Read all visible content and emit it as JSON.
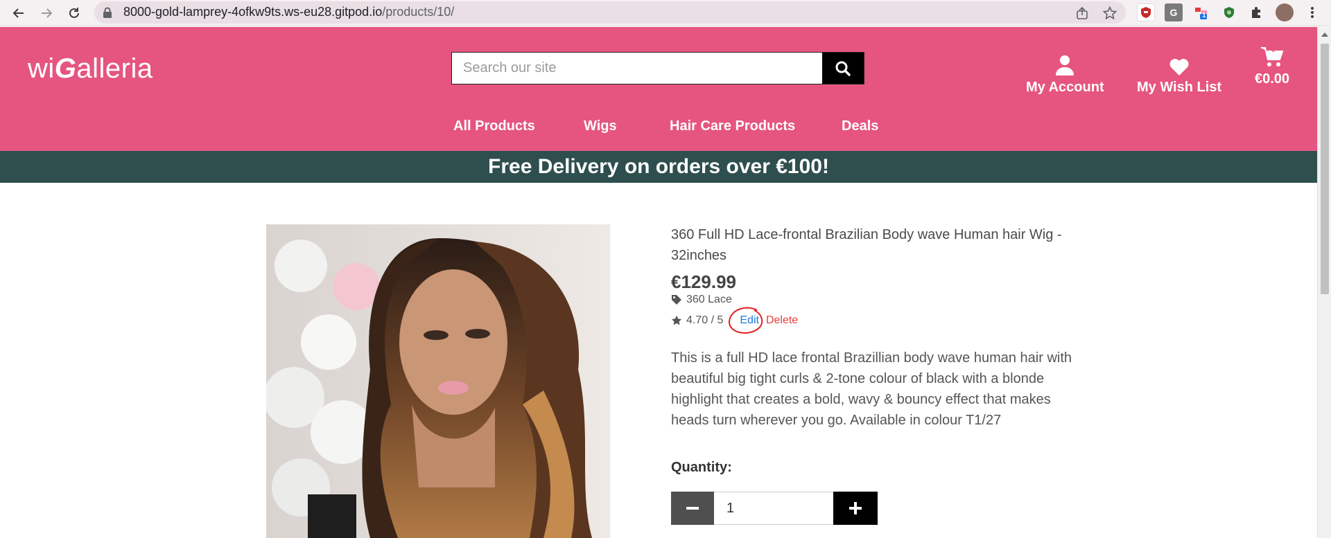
{
  "browser": {
    "url_host": "8000-gold-lamprey-4ofkw9ts.ws-eu28.gitpod.io",
    "url_path": "/products/10/",
    "extensions": [
      {
        "icon": "shield-ext-icon",
        "color": "#c62828",
        "text": ""
      },
      {
        "icon": "g-ext-icon",
        "color": "#7a7a7a",
        "text": "G"
      },
      {
        "icon": "hub-ext-icon",
        "color": "#e53935",
        "text": ""
      },
      {
        "icon": "green-shield-ext-icon",
        "color": "#2e7d32",
        "text": ""
      }
    ],
    "ext_badge": "1"
  },
  "site": {
    "logo_prefix": "wi",
    "logo_g": "G",
    "logo_suffix": "alleria",
    "search_placeholder": "Search our site",
    "account_label": "My Account",
    "wishlist_label": "My Wish List",
    "cart_total": "€0.00",
    "cart_count": "0",
    "nav": [
      "All Products",
      "Wigs",
      "Hair Care Products",
      "Deals"
    ],
    "banner": "Free Delivery on orders over €100!",
    "brand_color": "#e6557f",
    "banner_color": "#2f4f4f"
  },
  "product": {
    "title": "360 Full HD Lace-frontal Brazilian Body wave Human hair Wig - 32inches",
    "price": "€129.99",
    "category": "360 Lace",
    "rating": "4.70 / 5",
    "edit_label": "Edit",
    "delete_label": "Delete",
    "description": "This is a full HD lace frontal Brazillian body wave human hair with beautiful big tight curls & 2-tone colour of black with a blonde highlight that creates a bold, wavy & bouncy effect that makes heads turn wherever you go. Available in colour T1/27",
    "quantity_label": "Quantity:",
    "quantity": "1"
  }
}
